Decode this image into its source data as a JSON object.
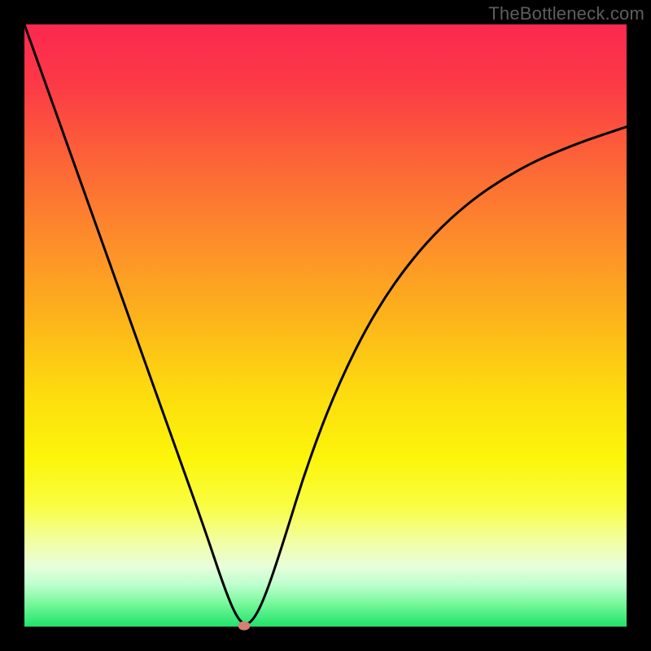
{
  "attribution": "TheBottleneck.com",
  "colors": {
    "frame": "#000000",
    "gradient_top": "#fb2850",
    "gradient_bottom": "#1fe36a",
    "curve": "#000000",
    "marker": "#d48072",
    "attribution_text": "#5e5e5e"
  },
  "chart_data": {
    "type": "line",
    "title": "",
    "xlabel": "",
    "ylabel": "",
    "xlim": [
      0,
      100
    ],
    "ylim": [
      0,
      100
    ],
    "grid": false,
    "legend": false,
    "annotations": [],
    "series": [
      {
        "name": "bottleneck-curve",
        "x": [
          0,
          5,
          10,
          15,
          20,
          25,
          30,
          33,
          35,
          36.5,
          38,
          40,
          43,
          47,
          52,
          58,
          65,
          73,
          82,
          91,
          100
        ],
        "values": [
          100,
          86,
          72,
          58,
          44,
          30,
          16,
          7,
          2,
          0.2,
          1,
          5,
          14,
          27,
          40,
          52,
          62,
          70,
          76,
          80,
          83
        ]
      }
    ],
    "marker": {
      "x": 36.5,
      "y": 0.2
    }
  }
}
